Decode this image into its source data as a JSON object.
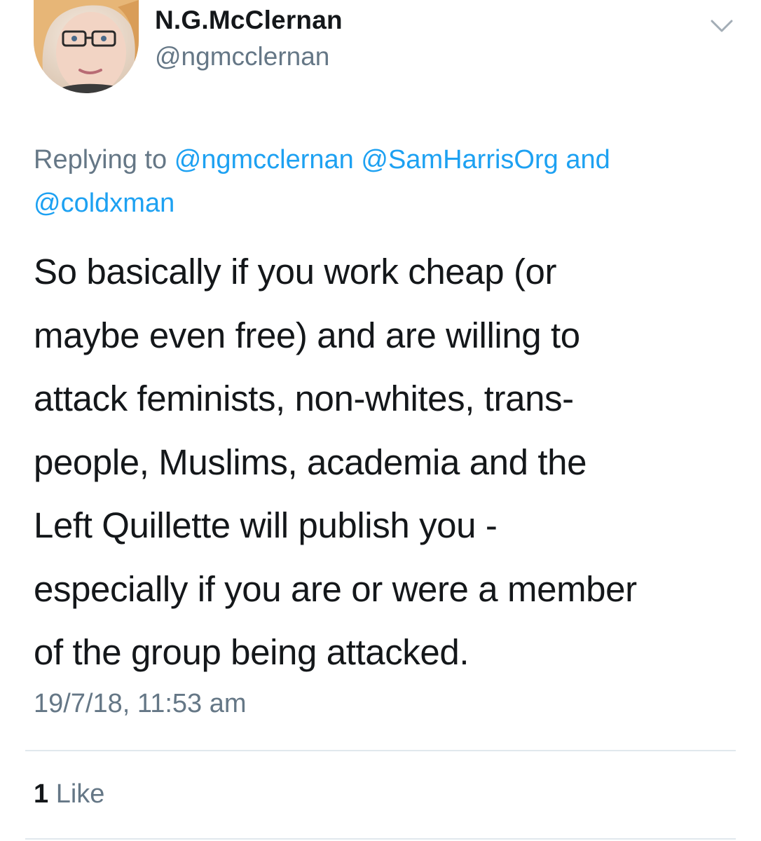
{
  "author": {
    "name": "N.G.McClernan",
    "handle": "@ngmcclernan",
    "avatar_icon": "profile-photo"
  },
  "menu_icon": "chevron-down-icon",
  "reply_context": {
    "prefix": "Replying to",
    "mentions": [
      "@ngmcclernan",
      "@SamHarrisOrg",
      "@coldxman"
    ],
    "conjunction": "and"
  },
  "tweet": {
    "lines": [
      "So basically if you work cheap (or",
      "maybe even free) and are willing to",
      "attack feminists, non-whites, trans-",
      "people, Muslims, academia and the",
      "Left Quillette will publish you -",
      "especially if you are or were a member",
      "of the group being attacked."
    ],
    "timestamp": "19/7/18, 11:53 am"
  },
  "stats": {
    "like_count": "1",
    "like_label": "Like"
  },
  "colors": {
    "text": "#14171a",
    "secondary": "#657786",
    "link": "#1da1f2",
    "divider": "#e1e8ed"
  }
}
